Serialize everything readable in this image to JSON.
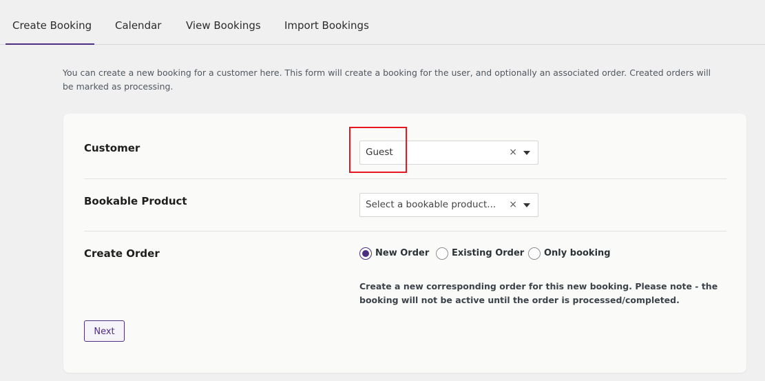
{
  "tabs": [
    {
      "label": "Create Booking",
      "active": true
    },
    {
      "label": "Calendar",
      "active": false
    },
    {
      "label": "View Bookings",
      "active": false
    },
    {
      "label": "Import Bookings",
      "active": false
    }
  ],
  "intro": "You can create a new booking for a customer here. This form will create a booking for the user, and optionally an associated order. Created orders will be marked as processing.",
  "form": {
    "customer": {
      "label": "Customer",
      "value": "Guest",
      "clear": "×"
    },
    "product": {
      "label": "Bookable Product",
      "placeholder": "Select a bookable product...",
      "clear": "×"
    },
    "order": {
      "label": "Create Order",
      "options": [
        {
          "label": "New Order",
          "checked": true
        },
        {
          "label": "Existing Order",
          "checked": false
        },
        {
          "label": "Only booking",
          "checked": false
        }
      ],
      "help": "Create a new corresponding order for this new booking. Please note - the booking will not be active until the order is processed/completed."
    },
    "next_label": "Next"
  },
  "colors": {
    "accent": "#4b2d83",
    "highlight": "#e8141e"
  }
}
